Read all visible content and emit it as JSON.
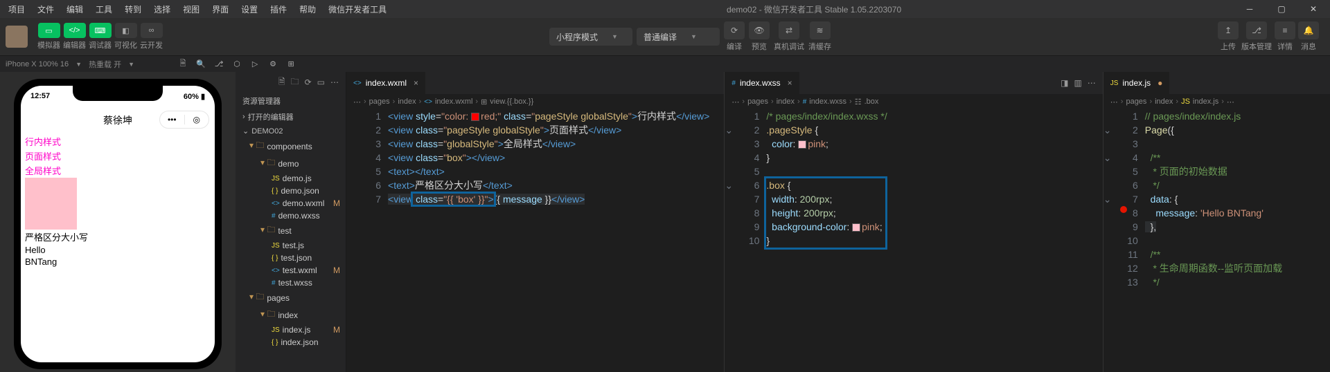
{
  "title": "demo02 - 微信开发者工具 Stable 1.05.2203070",
  "menus": [
    "项目",
    "文件",
    "编辑",
    "工具",
    "转到",
    "选择",
    "视图",
    "界面",
    "设置",
    "插件",
    "帮助",
    "微信开发者工具"
  ],
  "toolbar": {
    "tabs": [
      {
        "label": "模拟器"
      },
      {
        "label": "编辑器"
      },
      {
        "label": "调试器"
      },
      {
        "label": "可视化"
      },
      {
        "label": "云开发"
      }
    ],
    "compile_mode": "小程序模式",
    "compile_type": "普通编译",
    "actions": [
      {
        "label": "编译"
      },
      {
        "label": "预览"
      },
      {
        "label": "真机调试"
      },
      {
        "label": "清缓存"
      }
    ],
    "right": [
      {
        "label": "上传"
      },
      {
        "label": "版本管理"
      },
      {
        "label": "详情"
      },
      {
        "label": "消息"
      }
    ]
  },
  "subbar": {
    "device": "iPhone X 100% 16",
    "reload": "热重载 开"
  },
  "simulator": {
    "time": "12:57",
    "battery": "60%",
    "title": "蔡徐坤",
    "lines": [
      "行内样式",
      "页面样式",
      "全局样式"
    ],
    "strict": "严格区分大小写",
    "hello": "Hello",
    "tang": "BNTang"
  },
  "explorer": {
    "title": "资源管理器",
    "open_editors": "打开的编辑器",
    "project": "DEMO02",
    "tree": [
      {
        "name": "components",
        "type": "folder",
        "ind": 1
      },
      {
        "name": "demo",
        "type": "folder",
        "ind": 2
      },
      {
        "name": "demo.js",
        "type": "js",
        "ind": 3
      },
      {
        "name": "demo.json",
        "type": "json",
        "ind": 3
      },
      {
        "name": "demo.wxml",
        "type": "wxml",
        "ind": 3,
        "m": "M"
      },
      {
        "name": "demo.wxss",
        "type": "wxss",
        "ind": 3
      },
      {
        "name": "test",
        "type": "folder",
        "ind": 2
      },
      {
        "name": "test.js",
        "type": "js",
        "ind": 3
      },
      {
        "name": "test.json",
        "type": "json",
        "ind": 3
      },
      {
        "name": "test.wxml",
        "type": "wxml",
        "ind": 3,
        "m": "M"
      },
      {
        "name": "test.wxss",
        "type": "wxss",
        "ind": 3
      },
      {
        "name": "pages",
        "type": "folder",
        "ind": 1
      },
      {
        "name": "index",
        "type": "folder",
        "ind": 2
      },
      {
        "name": "index.js",
        "type": "js",
        "ind": 3,
        "m": "M"
      },
      {
        "name": "index.json",
        "type": "json",
        "ind": 3
      }
    ]
  },
  "editor1": {
    "tab": "index.wxml",
    "breadcrumb": [
      "pages",
      "index",
      "index.wxml",
      "view.{{.box.}}"
    ],
    "lines": [
      "1",
      "2",
      "3",
      "4",
      "5",
      "6",
      "7"
    ]
  },
  "editor2": {
    "tab": "index.wxss",
    "breadcrumb": [
      "pages",
      "index",
      "index.wxss",
      ".box"
    ],
    "lines": [
      "1",
      "2",
      "3",
      "4",
      "5",
      "6",
      "7",
      "8",
      "9",
      "10"
    ]
  },
  "editor3": {
    "tab": "index.js",
    "breadcrumb": [
      "pages",
      "index",
      "index.js"
    ],
    "lines": [
      "1",
      "2",
      "3",
      "4",
      "5",
      "6",
      "7",
      "8",
      "9",
      "10",
      "11",
      "12",
      "13"
    ]
  },
  "code": {
    "wxml_text1": "行内样式",
    "wxml_text2": "页面样式",
    "wxml_text3": "全局样式",
    "wxml_text4": "严格区分大小写",
    "wxss_cmt": "/* pages/index/index.wxss */",
    "js_cmt1": "// pages/index/index.js",
    "js_cmt2": " * 页面的初始数据",
    "js_cmt3": " * 生命周期函数--监听页面加载",
    "js_msg": "'Hello BNTang'"
  }
}
